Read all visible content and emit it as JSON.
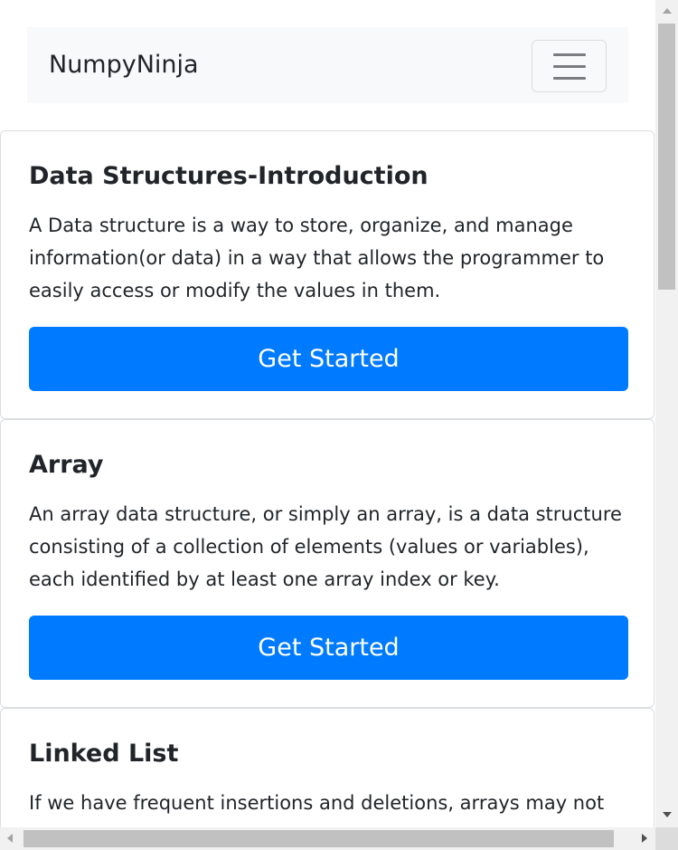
{
  "navbar": {
    "brand": "NumpyNinja",
    "toggler_icon": "hamburger-icon"
  },
  "cards": [
    {
      "title": "Data Structures-Introduction",
      "text": "A Data structure is a way to store, organize, and manage information(or data) in a way that allows the programmer to easily access or modify the values in them.",
      "button": "Get Started"
    },
    {
      "title": "Array",
      "text": "An array data structure, or simply an array, is a data structure consisting of a collection of elements (values or variables), each identified by at least one array index or key.",
      "button": "Get Started"
    },
    {
      "title": "Linked List",
      "text": "If we have frequent insertions and deletions, arrays may not"
    }
  ],
  "colors": {
    "primary": "#007bff",
    "navbar_bg": "#f8f9fa",
    "text": "#212529"
  }
}
